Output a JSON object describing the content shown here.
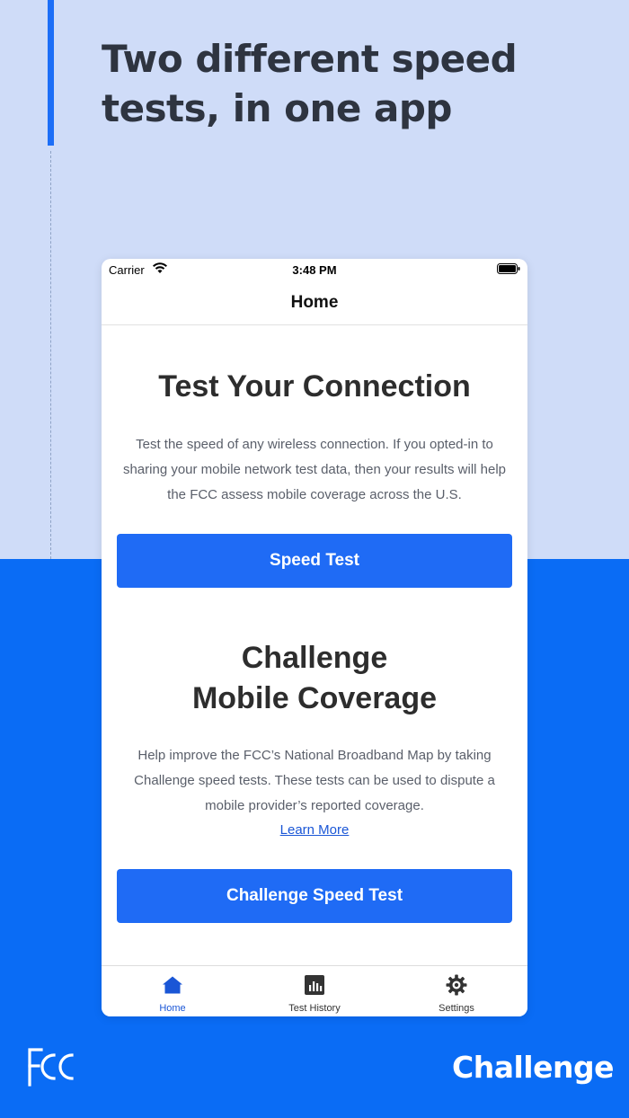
{
  "headline": "Two different speed tests, in one app",
  "status_bar": {
    "carrier": "Carrier",
    "time": "3:48 PM"
  },
  "nav": {
    "title": "Home"
  },
  "connection_section": {
    "title": "Test Your Connection",
    "description": "Test the speed of any wireless connection. If you opted-in to sharing your mobile network test data, then your results will help the FCC assess mobile coverage across the U.S.",
    "button_label": "Speed Test"
  },
  "challenge_section": {
    "title_line1": "Challenge",
    "title_line2": "Mobile Coverage",
    "description": "Help improve the FCC’s National Broadband Map by taking Challenge speed tests. These tests can be used to dispute a mobile provider’s reported coverage.",
    "learn_more": "Learn More",
    "button_label": "Challenge Speed Test"
  },
  "tab_bar": {
    "items": [
      {
        "label": "Home",
        "icon": "home-icon",
        "active": true
      },
      {
        "label": "Test History",
        "icon": "chart-icon",
        "active": false
      },
      {
        "label": "Settings",
        "icon": "gear-icon",
        "active": false
      }
    ]
  },
  "branding": {
    "fcc_logo": "FCC",
    "challenge_logo": "Challenge"
  },
  "colors": {
    "top_background": "#cfdcf8",
    "bottom_background": "#0a6cf5",
    "button": "#1f6bf5",
    "accent": "#1c6ef7",
    "active_tab": "#1a56d6"
  }
}
